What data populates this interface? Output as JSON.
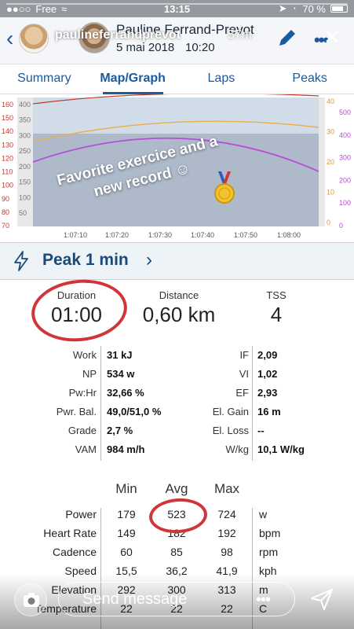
{
  "status_bar": {
    "carrier": "Free",
    "time": "13:15",
    "battery": "70 %"
  },
  "story": {
    "username": "paulineferrandprevot",
    "age": "57m"
  },
  "header": {
    "name": "Pauline Ferrand-Prevot",
    "date": "5 mai 2018",
    "time": "10:20"
  },
  "tabs": [
    "Summary",
    "Map/Graph",
    "Laps",
    "Peaks"
  ],
  "active_tab": "Map/Graph",
  "overlay": {
    "text": "Favorite exercice and a new record ☺"
  },
  "chart_data": {
    "type": "line",
    "x_ticks": [
      "1:07:10",
      "1:07:20",
      "1:07:30",
      "1:07:40",
      "1:07:50",
      "1:08:00"
    ],
    "left_axis_red": [
      "160",
      "150",
      "140",
      "130",
      "120",
      "110",
      "100",
      "90",
      "80",
      "70"
    ],
    "left_axis_gray": [
      "400",
      "350",
      "300",
      "250",
      "200",
      "150",
      "100",
      "50"
    ],
    "right_axis_orange": [
      "40",
      "30",
      "20",
      "10",
      "0"
    ],
    "right_axis_purple": [
      "500",
      "400",
      "300",
      "200",
      "100",
      "0"
    ],
    "colors": {
      "power": "#b84dd6",
      "cadence": "#e8b050",
      "heart": "#c0392b",
      "elevation": "#a8b4c4",
      "highlight": "#c5d3e3"
    }
  },
  "peak": {
    "label": "Peak 1 min"
  },
  "summary": [
    {
      "label": "Duration",
      "value": "01:00"
    },
    {
      "label": "Distance",
      "value": "0,60 km"
    },
    {
      "label": "TSS",
      "value": "4"
    }
  ],
  "metrics_left": [
    {
      "label": "Work",
      "value": "31 kJ"
    },
    {
      "label": "NP",
      "value": "534 w"
    },
    {
      "label": "Pw:Hr",
      "value": "32,66 %"
    },
    {
      "label": "Pwr. Bal.",
      "value": "49,0/51,0 %"
    },
    {
      "label": "Grade",
      "value": "2,7 %"
    },
    {
      "label": "VAM",
      "value": "984 m/h"
    }
  ],
  "metrics_right": [
    {
      "label": "IF",
      "value": "2,09"
    },
    {
      "label": "VI",
      "value": "1,02"
    },
    {
      "label": "EF",
      "value": "2,93"
    },
    {
      "label": "El. Gain",
      "value": "16 m"
    },
    {
      "label": "El. Loss",
      "value": "--"
    },
    {
      "label": "W/kg",
      "value": "10,1 W/kg"
    }
  ],
  "stats_head": {
    "min": "Min",
    "avg": "Avg",
    "max": "Max"
  },
  "stats": [
    {
      "name": "Power",
      "min": "179",
      "avg": "523",
      "max": "724",
      "unit": "w"
    },
    {
      "name": "Heart Rate",
      "min": "149",
      "avg": "182",
      "max": "192",
      "unit": "bpm"
    },
    {
      "name": "Cadence",
      "min": "60",
      "avg": "85",
      "max": "98",
      "unit": "rpm"
    },
    {
      "name": "Speed",
      "min": "15,5",
      "avg": "36,2",
      "max": "41,9",
      "unit": "kph"
    },
    {
      "name": "Elevation",
      "min": "292",
      "avg": "300",
      "max": "313",
      "unit": "m"
    },
    {
      "name": "Temperature",
      "min": "22",
      "avg": "22",
      "max": "22",
      "unit": "C"
    }
  ],
  "message": {
    "placeholder": "Send message"
  }
}
